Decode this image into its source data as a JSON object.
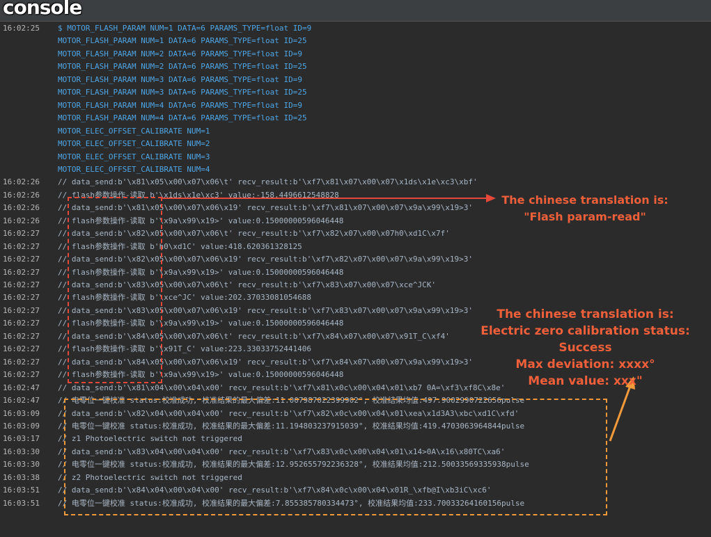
{
  "window": {
    "title": "console"
  },
  "log": [
    {
      "ts": "16:02:25",
      "msg": "$ MOTOR_FLASH_PARAM NUM=1 DATA=6 PARAMS_TYPE=float ID=9",
      "kind": "cmd"
    },
    {
      "ts": "",
      "msg": "MOTOR_FLASH_PARAM NUM=1 DATA=6 PARAMS_TYPE=float ID=25",
      "kind": "cmd"
    },
    {
      "ts": "",
      "msg": "MOTOR_FLASH_PARAM NUM=2 DATA=6 PARAMS_TYPE=float ID=9",
      "kind": "cmd"
    },
    {
      "ts": "",
      "msg": "MOTOR_FLASH_PARAM NUM=2 DATA=6 PARAMS_TYPE=float ID=25",
      "kind": "cmd"
    },
    {
      "ts": "",
      "msg": "MOTOR_FLASH_PARAM NUM=3 DATA=6 PARAMS_TYPE=float ID=9",
      "kind": "cmd"
    },
    {
      "ts": "",
      "msg": "MOTOR_FLASH_PARAM NUM=3 DATA=6 PARAMS_TYPE=float ID=25",
      "kind": "cmd"
    },
    {
      "ts": "",
      "msg": "MOTOR_FLASH_PARAM NUM=4 DATA=6 PARAMS_TYPE=float ID=9",
      "kind": "cmd"
    },
    {
      "ts": "",
      "msg": "MOTOR_FLASH_PARAM NUM=4 DATA=6 PARAMS_TYPE=float ID=25",
      "kind": "cmd"
    },
    {
      "ts": "",
      "msg": "MOTOR_ELEC_OFFSET_CALIBRATE NUM=1",
      "kind": "cmd"
    },
    {
      "ts": "",
      "msg": "MOTOR_ELEC_OFFSET_CALIBRATE NUM=2",
      "kind": "cmd"
    },
    {
      "ts": "",
      "msg": "MOTOR_ELEC_OFFSET_CALIBRATE NUM=3",
      "kind": "cmd"
    },
    {
      "ts": "",
      "msg": "MOTOR_ELEC_OFFSET_CALIBRATE NUM=4",
      "kind": "cmd"
    },
    {
      "ts": "16:02:26",
      "msg": "// data_send:b'\\x81\\x05\\x00\\x07\\x06\\t' recv_result:b'\\xf7\\x81\\x07\\x00\\x07\\x1ds\\x1e\\xc3\\xbf'",
      "kind": "log"
    },
    {
      "ts": "16:02:26",
      "msg": "// flash参数操作-读取 b'\\x1ds\\x1e\\xc3' value:-158.4496612548828",
      "kind": "log"
    },
    {
      "ts": "16:02:26",
      "msg": "// data_send:b'\\x81\\x05\\x00\\x07\\x06\\x19' recv_result:b'\\xf7\\x81\\x07\\x00\\x07\\x9a\\x99\\x19>3'",
      "kind": "log"
    },
    {
      "ts": "16:02:26",
      "msg": "// flash参数操作-读取 b'\\x9a\\x99\\x19>' value:0.15000000596046448",
      "kind": "log"
    },
    {
      "ts": "16:02:27",
      "msg": "// data_send:b'\\x82\\x05\\x00\\x07\\x06\\t' recv_result:b'\\xf7\\x82\\x07\\x00\\x07h0\\xd1C\\x7f'",
      "kind": "log"
    },
    {
      "ts": "16:02:27",
      "msg": "// flash参数操作-读取 b'h0\\xd1C' value:418.620361328125",
      "kind": "log"
    },
    {
      "ts": "16:02:27",
      "msg": "// data_send:b'\\x82\\x05\\x00\\x07\\x06\\x19' recv_result:b'\\xf7\\x82\\x07\\x00\\x07\\x9a\\x99\\x19>3'",
      "kind": "log"
    },
    {
      "ts": "16:02:27",
      "msg": "// flash参数操作-读取 b'\\x9a\\x99\\x19>' value:0.15000000596046448",
      "kind": "log"
    },
    {
      "ts": "16:02:27",
      "msg": "// data_send:b'\\x83\\x05\\x00\\x07\\x06\\t' recv_result:b'\\xf7\\x83\\x07\\x00\\x07\\xce^JCK'",
      "kind": "log"
    },
    {
      "ts": "16:02:27",
      "msg": "// flash参数操作-读取 b'\\xce^JC' value:202.37033081054688",
      "kind": "log"
    },
    {
      "ts": "16:02:27",
      "msg": "// data_send:b'\\x83\\x05\\x00\\x07\\x06\\x19' recv_result:b'\\xf7\\x83\\x07\\x00\\x07\\x9a\\x99\\x19>3'",
      "kind": "log"
    },
    {
      "ts": "16:02:27",
      "msg": "// flash参数操作-读取 b'\\x9a\\x99\\x19>' value:0.15000000596046448",
      "kind": "log"
    },
    {
      "ts": "16:02:27",
      "msg": "// data_send:b'\\x84\\x05\\x00\\x07\\x06\\t' recv_result:b'\\xf7\\x84\\x07\\x00\\x07\\x91T_C\\xf4'",
      "kind": "log"
    },
    {
      "ts": "16:02:27",
      "msg": "// flash参数操作-读取 b'\\x91T_C' value:223.33033752441406",
      "kind": "log"
    },
    {
      "ts": "16:02:27",
      "msg": "// data_send:b'\\x84\\x05\\x00\\x07\\x06\\x19' recv_result:b'\\xf7\\x84\\x07\\x00\\x07\\x9a\\x99\\x19>3'",
      "kind": "log"
    },
    {
      "ts": "16:02:27",
      "msg": "// flash参数操作-读取 b'\\x9a\\x99\\x19>' value:0.15000000596046448",
      "kind": "log"
    },
    {
      "ts": "16:02:47",
      "msg": "// data_send:b'\\x81\\x04\\x00\\x04\\x00' recv_result:b'\\xf7\\x81\\x0c\\x00\\x04\\x01\\xb7 0A=\\xf3\\xf8C\\x8e'",
      "kind": "log"
    },
    {
      "ts": "16:02:47",
      "msg": "// 电零位一键校准 status:校准成功, 校准结果的最大偏差:11.007987022399902°, 校准结果均值:497.9002990722656pulse",
      "kind": "log"
    },
    {
      "ts": "16:03:09",
      "msg": "// data_send:b'\\x82\\x04\\x00\\x04\\x00' recv_result:b'\\xf7\\x82\\x0c\\x00\\x04\\x01\\xea\\x1d3A3\\xbc\\xd1C\\xfd'",
      "kind": "log"
    },
    {
      "ts": "16:03:09",
      "msg": "// 电零位一键校准 status:校准成功, 校准结果的最大偏差:11.194803237915039°, 校准结果均值:419.4703063964844pulse",
      "kind": "log"
    },
    {
      "ts": "16:03:17",
      "msg": "// z1 Photoelectric switch not triggered",
      "kind": "log"
    },
    {
      "ts": "16:03:30",
      "msg": "// data_send:b'\\x83\\x04\\x00\\x04\\x00' recv_result:b'\\xf7\\x83\\x0c\\x00\\x04\\x01\\x14>0A\\x16\\x80TC\\xa6'",
      "kind": "log"
    },
    {
      "ts": "16:03:30",
      "msg": "// 电零位一键校准 status:校准成功, 校准结果的最大偏差:12.952655792236328°, 校准结果均值:212.50033569335938pulse",
      "kind": "log"
    },
    {
      "ts": "16:03:38",
      "msg": "// z2 Photoelectric switch not triggered",
      "kind": "log"
    },
    {
      "ts": "16:03:51",
      "msg": "// data_send:b'\\x84\\x04\\x00\\x04\\x00' recv_result:b'\\xf7\\x84\\x0c\\x00\\x04\\x01R_\\xfb@I\\xb3iC\\xc6'",
      "kind": "log"
    },
    {
      "ts": "16:03:51",
      "msg": "// 电零位一键校准 status:校准成功, 校准结果的最大偏差:7.855385780334473°, 校准结果均值:233.70033264160156pulse",
      "kind": "log"
    }
  ],
  "annotations": {
    "flash": {
      "color": "#ee5f3a",
      "lines": [
        "The chinese translation is:",
        "\"Flash param-read\""
      ]
    },
    "calib": {
      "color": "#f29a3a",
      "text_color": "#ee5f3a",
      "lines": [
        "The chinese translation is:",
        "Electric zero calibration status: Success",
        "Max deviation: xxxx°",
        "Mean value: xxx\""
      ]
    }
  }
}
